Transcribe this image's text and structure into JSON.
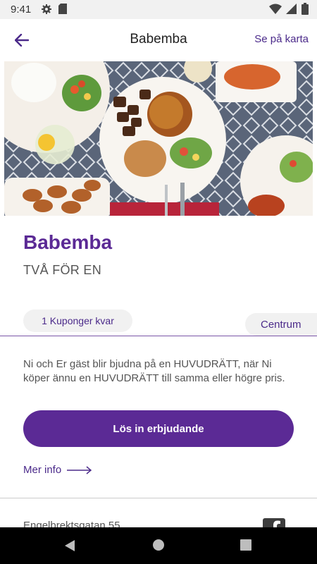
{
  "status_bar": {
    "time": "9:41",
    "icons": [
      "gear-icon",
      "sd-card-icon",
      "wifi-icon",
      "signal-icon",
      "battery-icon"
    ]
  },
  "app_bar": {
    "title": "Babemba",
    "map_link": "Se på karta",
    "back_icon": "arrow-left-icon"
  },
  "hero": {
    "image": "restaurant-food-photo"
  },
  "venue": {
    "name": "Babemba",
    "offer": "TVÅ FÖR EN"
  },
  "chips": {
    "coupons": "1 Kuponger kvar",
    "area": "Centrum"
  },
  "description": "Ni och Er gäst blir bjudna på en HUVUDRÄTT, när Ni köper ännu en HUVUDRÄTT till samma eller högre pris.",
  "actions": {
    "redeem": "Lös in erbjudande",
    "more_info": "Mer info"
  },
  "footer": {
    "address": "Engelbrektsgatan 55"
  },
  "colors": {
    "accent": "#5b2a95",
    "accent_text": "#4b2a8a"
  }
}
